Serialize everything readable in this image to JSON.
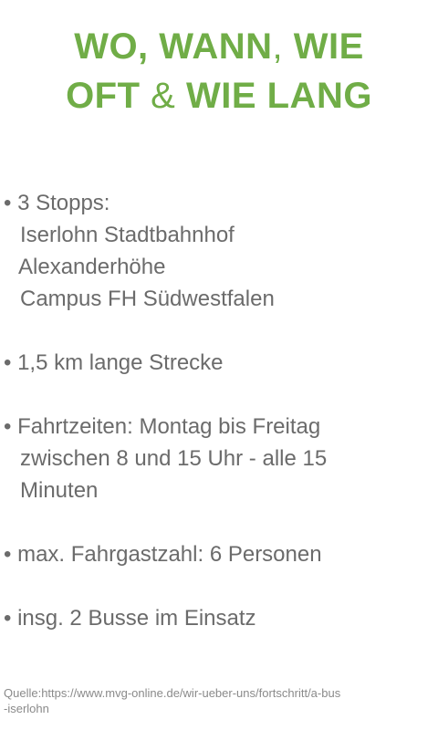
{
  "title": {
    "line1_part1": "WO,  WANN",
    "line1_comma": ",",
    "line1_part2": " WIE",
    "line2_part1": "OFT ",
    "line2_amp": "&",
    "line2_part2": " WIE LANG"
  },
  "bullets": [
    {
      "lines": [
        "• 3 Stopps:",
        "Iserlohn Stadtbahnhof",
        "Alexanderhöhe",
        "Campus FH Südwestfalen"
      ]
    },
    {
      "lines": [
        "• 1,5 km lange Strecke"
      ]
    },
    {
      "lines": [
        "• Fahrtzeiten: Montag bis Freitag",
        "zwischen 8 und 15 Uhr - alle 15",
        "Minuten"
      ]
    },
    {
      "lines": [
        "• max. Fahrgastzahl: 6 Personen"
      ]
    },
    {
      "lines": [
        "• insg. 2 Busse im Einsatz"
      ]
    }
  ],
  "source": {
    "line1": "Quelle:https://www.mvg-online.de/wir-ueber-uns/fortschritt/a-bus",
    "line2": "-iserlohn"
  },
  "colors": {
    "title_green": "#70ad47",
    "body_gray": "#6b6b6b"
  }
}
